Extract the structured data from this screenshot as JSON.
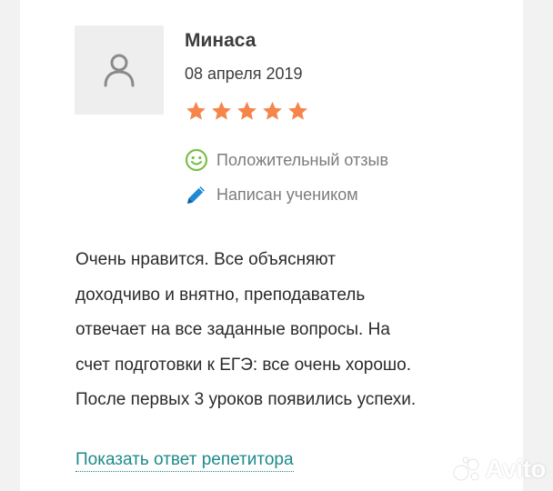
{
  "review": {
    "author_name": "Минаса",
    "date": "08 апреля 2019",
    "rating": 5,
    "rating_max": 5,
    "star_color": "#f5854b",
    "sentiment_label": "Положительный отзыв",
    "sentiment_icon": "smile-icon",
    "sentiment_color": "#7bbf4a",
    "author_role_label": "Написан учеником",
    "author_role_icon": "pencil-icon",
    "author_role_color": "#1e8ad6",
    "text_lines": [
      "Очень нравится. Все объясняют",
      "доходчиво и внятно, преподаватель",
      "отвечает на все заданные вопросы. На",
      "счет подготовки к ЕГЭ: все очень хорошо.",
      "После первых 3 уроков появились успехи."
    ],
    "show_reply_link": "Показать ответ репетитора",
    "link_color": "#1e8a8a",
    "avatar_icon": "user-icon"
  },
  "watermark": {
    "text": "Avito"
  }
}
